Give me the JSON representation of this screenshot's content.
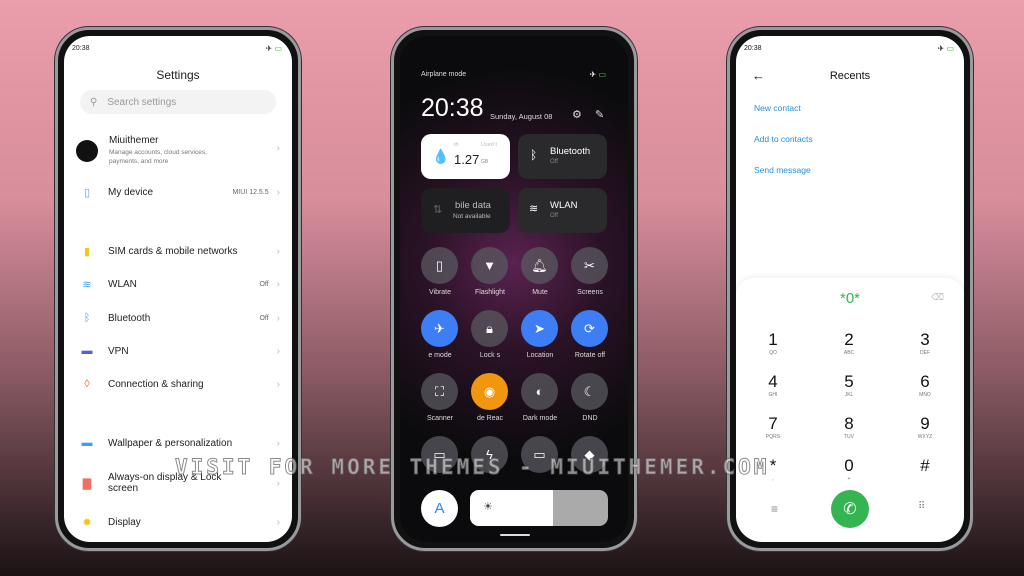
{
  "status_time": "20:38",
  "settings": {
    "title": "Settings",
    "search_placeholder": "Search settings",
    "account": {
      "name": "Miuithemer",
      "desc1": "Manage accounts, cloud services,",
      "desc2": "payments, and more"
    },
    "my_device": {
      "label": "My device",
      "value": "MIUI 12.5.5"
    },
    "items": [
      {
        "label": "SIM cards & mobile networks",
        "value": "",
        "icon": "sim-icon"
      },
      {
        "label": "WLAN",
        "value": "Off",
        "icon": "wifi-icon"
      },
      {
        "label": "Bluetooth",
        "value": "Off",
        "icon": "bluetooth-icon"
      },
      {
        "label": "VPN",
        "value": "",
        "icon": "vpn-icon"
      },
      {
        "label": "Connection & sharing",
        "value": "",
        "icon": "connection-icon"
      },
      {
        "label": "Wallpaper & personalization",
        "value": "",
        "icon": "wallpaper-icon"
      },
      {
        "label": "Always-on display & Lock",
        "label2": "screen",
        "value": "",
        "icon": "lock-icon"
      },
      {
        "label": "Display",
        "value": "",
        "icon": "sun-icon"
      }
    ]
  },
  "control_center": {
    "airplane_label": "Airplane mode",
    "time": "20:38",
    "date": "Sunday, August 08",
    "data_tile": {
      "small1": "th",
      "small2": "Used t",
      "value": "1.27",
      "unit": "GB"
    },
    "bluetooth": {
      "label": "Bluetooth",
      "state": "Off"
    },
    "mobile": {
      "label": "bile data",
      "state": "Not available"
    },
    "wlan": {
      "label": "WLAN",
      "state": "Off"
    },
    "toggles": [
      {
        "label": "Vibrate",
        "icon": "vibrate-icon",
        "active": false
      },
      {
        "label": "Flashlight",
        "icon": "flashlight-icon",
        "active": false
      },
      {
        "label": "Mute",
        "icon": "bell-icon",
        "active": false
      },
      {
        "label": "Screens",
        "icon": "screenshot-icon",
        "active": false
      },
      {
        "label": "e mode",
        "icon": "airplane-icon",
        "active": true
      },
      {
        "label": "Lock s",
        "icon": "lock-icon",
        "active": false
      },
      {
        "label": "Location",
        "icon": "location-icon",
        "active": true
      },
      {
        "label": "Rotate off",
        "icon": "rotate-lock-icon",
        "active": true
      },
      {
        "label": "Scanner",
        "icon": "scanner-icon",
        "active": false
      },
      {
        "label": "de    Reac",
        "icon": "eye-icon",
        "active": true
      },
      {
        "label": "Dark mode",
        "icon": "dark-mode-icon",
        "active": false
      },
      {
        "label": "DND",
        "icon": "moon-icon",
        "active": false
      },
      {
        "label": "",
        "icon": "battery-saver-icon",
        "active": false
      },
      {
        "label": "",
        "icon": "lightning-icon",
        "active": false
      },
      {
        "label": "",
        "icon": "cast-icon",
        "active": false
      },
      {
        "label": "",
        "icon": "link-icon",
        "active": false
      }
    ],
    "auto_brightness": "A",
    "brightness_percent": 60,
    "colors": {
      "blue": "#3d7ef5",
      "orange": "#f0960f"
    }
  },
  "dialer": {
    "title": "Recents",
    "links": [
      "New contact",
      "Add to contacts",
      "Send message"
    ],
    "input": "*0*",
    "keys": [
      [
        "1",
        "QO"
      ],
      [
        "2",
        "ABC"
      ],
      [
        "3",
        "DEF"
      ],
      [
        "4",
        "GHI"
      ],
      [
        "5",
        "JKL"
      ],
      [
        "6",
        "MNO"
      ],
      [
        "7",
        "PQRS"
      ],
      [
        "8",
        "TUV"
      ],
      [
        "9",
        "WXYZ"
      ],
      [
        "*",
        ","
      ],
      [
        "0",
        "+"
      ],
      [
        "#",
        ""
      ]
    ],
    "call_color": "#34b552"
  },
  "watermark": "VISIT FOR MORE THEMES - MIUITHEMER.COM"
}
